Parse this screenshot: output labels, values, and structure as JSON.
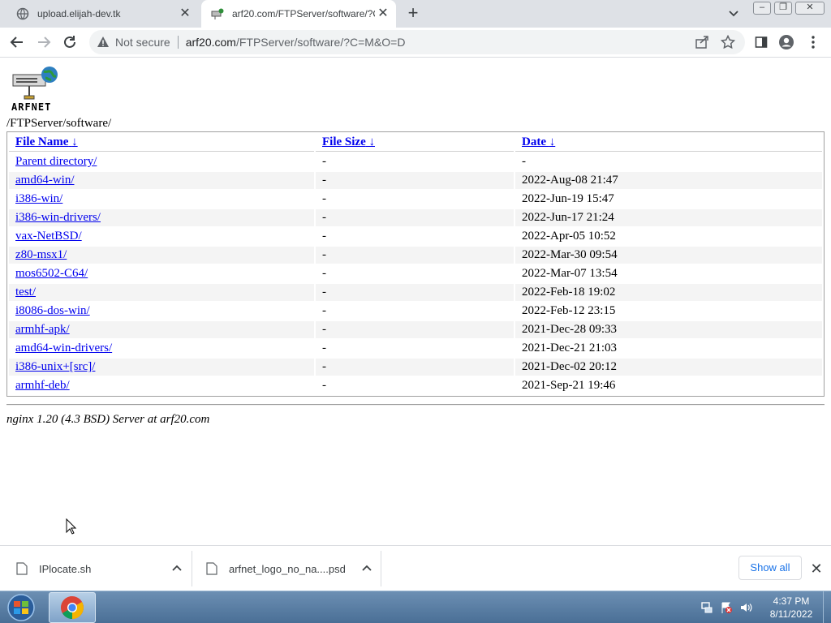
{
  "browser": {
    "tabs": [
      {
        "title": "upload.elijah-dev.tk",
        "close": "✕",
        "favicon": "globe-icon"
      },
      {
        "title": "arf20.com/FTPServer/software/?C",
        "close": "✕",
        "favicon": "server-favicon"
      }
    ],
    "new_tab": "+",
    "window_controls": {
      "minimize": "–",
      "maximize": "❐",
      "close": "✕"
    },
    "security_label": "Not secure",
    "url_host": "arf20.com",
    "url_path": "/FTPServer/software/?C=M&O=D"
  },
  "page": {
    "logo_text": "ARFNET",
    "path": "/FTPServer/software/",
    "columns": [
      {
        "label": "File Name",
        "sort": "↓"
      },
      {
        "label": "File Size",
        "sort": "↓"
      },
      {
        "label": "Date",
        "sort": "↓"
      }
    ],
    "rows": [
      {
        "name": "Parent directory/",
        "size": "-",
        "date": "-"
      },
      {
        "name": "amd64-win/",
        "size": "-",
        "date": "2022-Aug-08 21:47"
      },
      {
        "name": "i386-win/",
        "size": "-",
        "date": "2022-Jun-19 15:47"
      },
      {
        "name": "i386-win-drivers/",
        "size": "-",
        "date": "2022-Jun-17 21:24"
      },
      {
        "name": "vax-NetBSD/",
        "size": "-",
        "date": "2022-Apr-05 10:52"
      },
      {
        "name": "z80-msx1/",
        "size": "-",
        "date": "2022-Mar-30 09:54"
      },
      {
        "name": "mos6502-C64/",
        "size": "-",
        "date": "2022-Mar-07 13:54"
      },
      {
        "name": "test/",
        "size": "-",
        "date": "2022-Feb-18 19:02"
      },
      {
        "name": "i8086-dos-win/",
        "size": "-",
        "date": "2022-Feb-12 23:15"
      },
      {
        "name": "armhf-apk/",
        "size": "-",
        "date": "2021-Dec-28 09:33"
      },
      {
        "name": "amd64-win-drivers/",
        "size": "-",
        "date": "2021-Dec-21 21:03"
      },
      {
        "name": "i386-unix+[src]/",
        "size": "-",
        "date": "2021-Dec-02 20:12"
      },
      {
        "name": "armhf-deb/",
        "size": "-",
        "date": "2021-Sep-21 19:46"
      }
    ],
    "footer": "nginx 1.20 (4.3 BSD) Server at arf20.com"
  },
  "downloads": {
    "items": [
      {
        "name": "IPlocate.sh"
      },
      {
        "name": "arfnet_logo_no_na....psd"
      }
    ],
    "show_all": "Show all",
    "close": "✕"
  },
  "taskbar": {
    "time": "4:37 PM",
    "date": "8/11/2022"
  },
  "colors": {
    "link": "#0000ee",
    "accent": "#1a73e8",
    "taskbar": "#5b7fa6"
  }
}
